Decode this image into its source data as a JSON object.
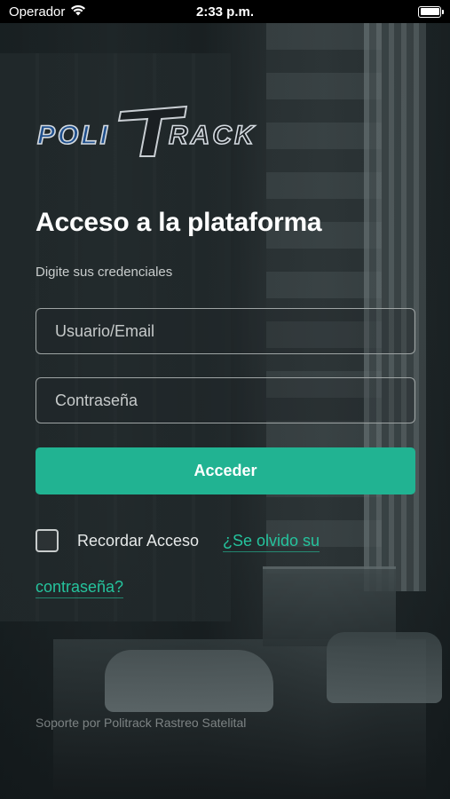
{
  "status_bar": {
    "carrier": "Operador",
    "time": "2:33 p.m."
  },
  "logo": {
    "text": "POLITRACK"
  },
  "login": {
    "title": "Acceso a la plataforma",
    "subtitle": "Digite sus credenciales",
    "username_placeholder": "Usuario/Email",
    "password_placeholder": "Contraseña",
    "submit_label": "Acceder",
    "remember_label": "Recordar Acceso",
    "remember_checked": false,
    "forgot_line1": "¿Se olvido su",
    "forgot_line2": "contraseña?"
  },
  "footer": {
    "text": "Soporte por Politrack Rastreo Satelital"
  },
  "colors": {
    "accent": "#21b392",
    "link": "#25c39d",
    "status_bar_bg": "#000000"
  }
}
